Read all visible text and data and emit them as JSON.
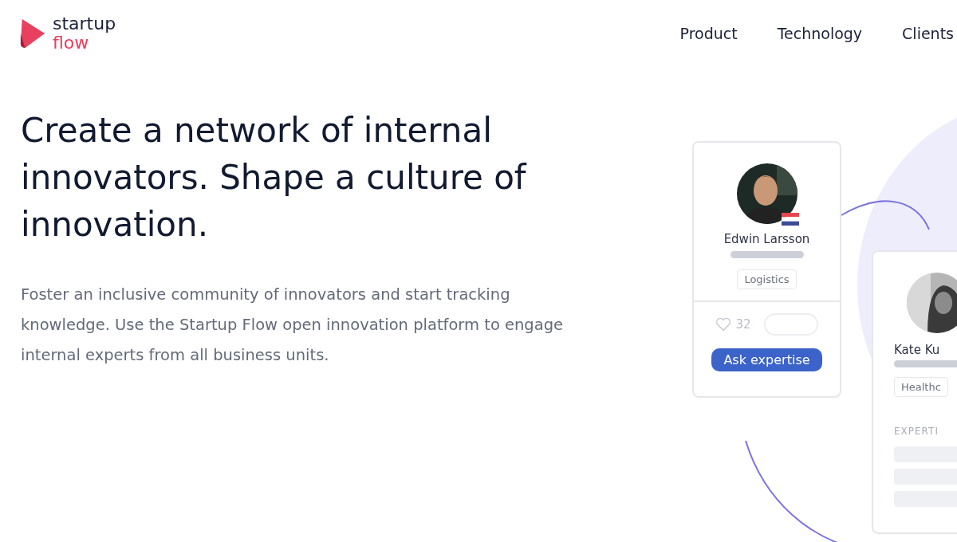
{
  "header": {
    "logo": {
      "line1": "startup",
      "line2": "flow"
    },
    "nav": [
      {
        "label": "Product"
      },
      {
        "label": "Technology"
      },
      {
        "label": "Clients"
      }
    ]
  },
  "hero": {
    "title": "Create a network of internal innovators. Shape a culture of innovation.",
    "description": "Foster an inclusive community of innovators and start tracking knowledge. Use the Startup Flow open innovation platform to engage internal experts from all business units."
  },
  "cards": [
    {
      "kind": "expert",
      "name": "Edwin Larsson",
      "tag": "Logistics",
      "likes": "32",
      "button": "Ask expertise"
    },
    {
      "kind": "profile",
      "name": "Kate Ku",
      "tag": "Healthc",
      "section_label": "EXPERTI"
    }
  ]
}
